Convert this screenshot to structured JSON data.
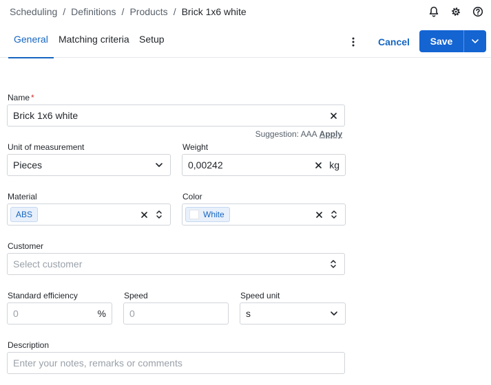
{
  "breadcrumb": {
    "items": [
      "Scheduling",
      "Definitions",
      "Products"
    ],
    "current": "Brick 1x6 white"
  },
  "top_icons": [
    "bell-icon",
    "gear-icon",
    "help-icon"
  ],
  "tabs": [
    {
      "label": "General",
      "active": true
    },
    {
      "label": "Matching criteria",
      "active": false
    },
    {
      "label": "Setup",
      "active": false
    }
  ],
  "actions": {
    "cancel_label": "Cancel",
    "save_label": "Save"
  },
  "form": {
    "name": {
      "label": "Name",
      "required_mark": "*",
      "value": "Brick 1x6 white"
    },
    "suggestion": {
      "text": "Suggestion: AAA",
      "action": "Apply"
    },
    "unit": {
      "label": "Unit of measurement",
      "value": "Pieces"
    },
    "weight": {
      "label": "Weight",
      "value": "0,00242",
      "unit": "kg"
    },
    "material": {
      "label": "Material",
      "chip": "ABS"
    },
    "color": {
      "label": "Color",
      "chip": "White"
    },
    "customer": {
      "label": "Customer",
      "placeholder": "Select customer"
    },
    "efficiency": {
      "label": "Standard efficiency",
      "placeholder": "0",
      "suffix": "%"
    },
    "speed": {
      "label": "Speed",
      "placeholder": "0"
    },
    "speed_unit": {
      "label": "Speed unit",
      "value": "s"
    },
    "description": {
      "label": "Description",
      "placeholder": "Enter your notes, remarks or comments"
    }
  },
  "colors": {
    "accent": "#1565c0",
    "primary_button": "#1464d2",
    "required": "#d32f2f"
  }
}
